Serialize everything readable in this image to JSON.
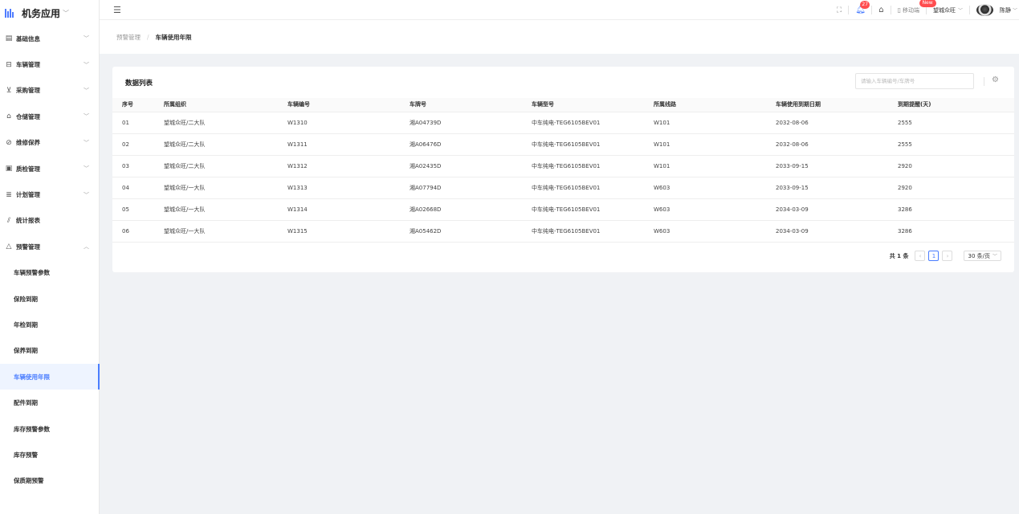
{
  "app": {
    "title": "机务应用"
  },
  "sidebar": {
    "items": [
      {
        "label": "基础信息",
        "icon": "document-icon",
        "glyph": "▤"
      },
      {
        "label": "车辆管理",
        "icon": "vehicle-icon",
        "glyph": "⊟"
      },
      {
        "label": "采购管理",
        "icon": "cart-icon",
        "glyph": "⊻"
      },
      {
        "label": "仓储管理",
        "icon": "warehouse-icon",
        "glyph": "⌂"
      },
      {
        "label": "维修保养",
        "icon": "wrench-icon",
        "glyph": "⊘"
      },
      {
        "label": "质检管理",
        "icon": "inspection-icon",
        "glyph": "▣"
      },
      {
        "label": "计划管理",
        "icon": "plan-icon",
        "glyph": "≣"
      },
      {
        "label": "统计报表",
        "icon": "chart-icon",
        "glyph": "⫽"
      },
      {
        "label": "预警管理",
        "icon": "warning-icon",
        "glyph": "△"
      }
    ],
    "submenu": [
      "车辆预警参数",
      "保险到期",
      "年检到期",
      "保养到期",
      "车辆使用年限",
      "配件到期",
      "库存预警参数",
      "库存预警",
      "保质期预警"
    ],
    "active_sub": "车辆使用年限"
  },
  "header": {
    "notification_count": "27",
    "mobile_label": "移动端",
    "new_badge": "New",
    "org": "望城众旺",
    "user": "陈静"
  },
  "breadcrumb": {
    "parent": "预警管理",
    "separator": "/",
    "current": "车辆使用年限"
  },
  "card": {
    "title": "数据列表",
    "search_placeholder": "请输入车辆编号/车牌号",
    "columns": [
      "序号",
      "所属组织",
      "车辆编号",
      "车牌号",
      "车辆型号",
      "所属线路",
      "车辆使用到期日期",
      "到期提醒(天)"
    ],
    "rows": [
      [
        "01",
        "望城众旺/二大队",
        "W1310",
        "湘A04739D",
        "中车纯电-TEG6105BEV01",
        "W101",
        "2032-08-06",
        "2555"
      ],
      [
        "02",
        "望城众旺/二大队",
        "W1311",
        "湘A06476D",
        "中车纯电-TEG6105BEV01",
        "W101",
        "2032-08-06",
        "2555"
      ],
      [
        "03",
        "望城众旺/二大队",
        "W1312",
        "湘A02435D",
        "中车纯电-TEG6105BEV01",
        "W101",
        "2033-09-15",
        "2920"
      ],
      [
        "04",
        "望城众旺/一大队",
        "W1313",
        "湘A07794D",
        "中车纯电-TEG6105BEV01",
        "W603",
        "2033-09-15",
        "2920"
      ],
      [
        "05",
        "望城众旺/一大队",
        "W1314",
        "湘A02668D",
        "中车纯电-TEG6105BEV01",
        "W603",
        "2034-03-09",
        "3286"
      ],
      [
        "06",
        "望城众旺/一大队",
        "W1315",
        "湘A05462D",
        "中车纯电-TEG6105BEV01",
        "W603",
        "2034-03-09",
        "3286"
      ]
    ]
  },
  "pagination": {
    "total": "共 1 条",
    "current_page": "1",
    "page_size": "30 条/页"
  },
  "colors": {
    "accent": "#4a7dff",
    "badge": "#ff4d4f"
  }
}
